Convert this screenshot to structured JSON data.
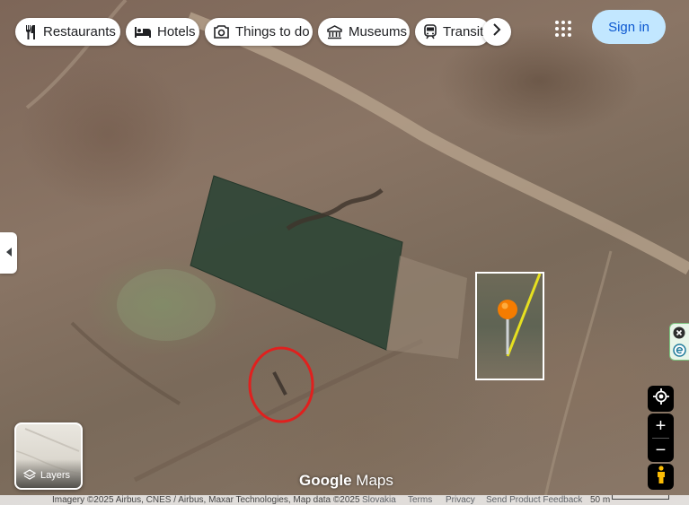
{
  "chips": [
    {
      "label": "Restaurants",
      "icon": "fork-knife-icon"
    },
    {
      "label": "Hotels",
      "icon": "bed-icon"
    },
    {
      "label": "Things to do",
      "icon": "camera-icon"
    },
    {
      "label": "Museums",
      "icon": "museum-icon"
    },
    {
      "label": "Transit",
      "icon": "train-icon"
    }
  ],
  "header": {
    "sign_in": "Sign in",
    "apps_icon": "apps-grid-icon"
  },
  "map": {
    "wordmark_google": "Google",
    "wordmark_maps": "Maps"
  },
  "controls": {
    "layers_label": "Layers",
    "zoom_in": "+",
    "zoom_out": "−"
  },
  "footer": {
    "imagery": "Imagery ©2025 Airbus, CNES / Airbus, Maxar Technologies, Map data ©2025",
    "country": "Slovakia",
    "terms": "Terms",
    "privacy": "Privacy",
    "feedback": "Send Product Feedback",
    "scale": "50 m"
  },
  "colors": {
    "accent": "#c2e7ff",
    "accent_text": "#0b57d0",
    "marker": "#f57c00",
    "circle": "#e0201e"
  }
}
